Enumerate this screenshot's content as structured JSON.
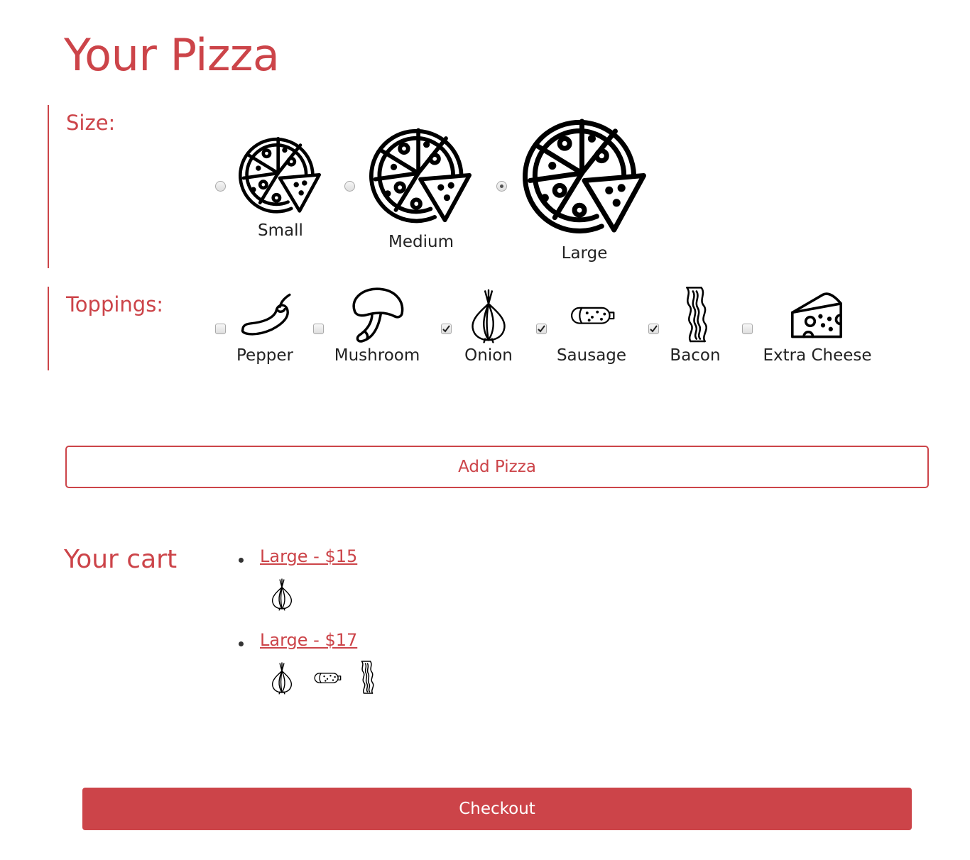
{
  "colors": {
    "accent": "#cc4449",
    "text": "#222222",
    "white": "#ffffff"
  },
  "title": "Your Pizza",
  "size": {
    "label": "Size:",
    "options": [
      {
        "label": "Small",
        "selected": false,
        "icon": "pizza-icon"
      },
      {
        "label": "Medium",
        "selected": false,
        "icon": "pizza-icon"
      },
      {
        "label": "Large",
        "selected": true,
        "icon": "pizza-icon"
      }
    ]
  },
  "toppings": {
    "label": "Toppings:",
    "options": [
      {
        "label": "Pepper",
        "checked": false,
        "icon": "pepper-icon"
      },
      {
        "label": "Mushroom",
        "checked": false,
        "icon": "mushroom-icon"
      },
      {
        "label": "Onion",
        "checked": true,
        "icon": "onion-icon"
      },
      {
        "label": "Sausage",
        "checked": true,
        "icon": "sausage-icon"
      },
      {
        "label": "Bacon",
        "checked": true,
        "icon": "bacon-icon"
      },
      {
        "label": "Extra Cheese",
        "checked": false,
        "icon": "cheese-icon"
      }
    ]
  },
  "add_button": "Add Pizza",
  "cart": {
    "title": "Your cart",
    "items": [
      {
        "label": "Large - $15",
        "toppings": [
          "onion-icon"
        ]
      },
      {
        "label": "Large - $17",
        "toppings": [
          "onion-icon",
          "sausage-icon",
          "bacon-icon"
        ]
      }
    ]
  },
  "checkout_button": "Checkout"
}
